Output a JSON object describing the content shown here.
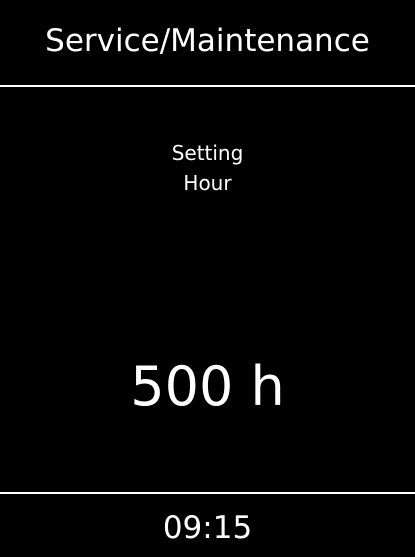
{
  "header": {
    "title": "Service/Maintenance"
  },
  "setting": {
    "label_line1": "Setting",
    "label_line2": "Hour",
    "value": "500 h"
  },
  "footer": {
    "time": "09:15"
  },
  "colors": {
    "background": "#000000",
    "foreground": "#ffffff"
  }
}
